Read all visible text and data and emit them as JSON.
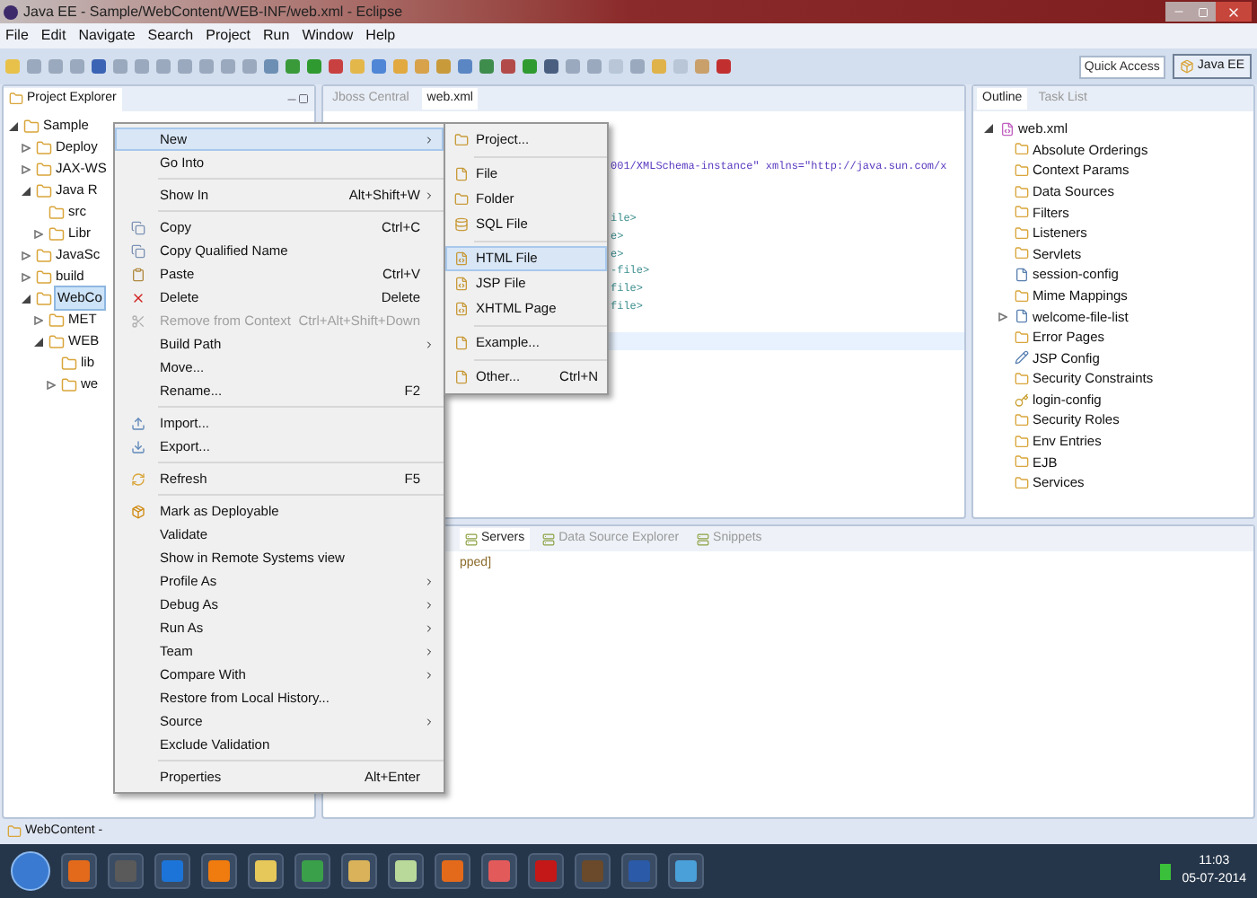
{
  "window": {
    "title": "Java EE - Sample/WebContent/WEB-INF/web.xml - Eclipse"
  },
  "menu_bar": [
    "File",
    "Edit",
    "Navigate",
    "Search",
    "Project",
    "Run",
    "Window",
    "Help"
  ],
  "quick_access": {
    "placeholder": "Quick Access"
  },
  "perspective": {
    "label": "Java EE",
    "selected": true
  },
  "project_explorer": {
    "tab": "Project Explorer",
    "tree": [
      {
        "label": "Sample",
        "expanded": true,
        "selected": false,
        "children": [
          {
            "label": "Deploy",
            "expanded": false,
            "selected": false
          },
          {
            "label": "JAX-WS",
            "expanded": false,
            "selected": false
          },
          {
            "label": "Java R",
            "expanded": true,
            "selected": false,
            "children": [
              {
                "label": "src",
                "selected": false
              },
              {
                "label": "Libr",
                "expanded": false,
                "selected": false
              }
            ]
          },
          {
            "label": "JavaSc",
            "expanded": false,
            "selected": false
          },
          {
            "label": "build",
            "expanded": false,
            "selected": false
          },
          {
            "label": "WebCo",
            "expanded": true,
            "selected": true,
            "children": [
              {
                "label": "MET",
                "expanded": false,
                "selected": false
              },
              {
                "label": "WEB",
                "expanded": true,
                "selected": false,
                "children": [
                  {
                    "label": "lib",
                    "selected": false
                  },
                  {
                    "label": "we",
                    "expanded": false,
                    "selected": false
                  }
                ]
              }
            ]
          }
        ]
      }
    ]
  },
  "editor": {
    "tabs": [
      {
        "label": "Jboss Central",
        "selected": false
      },
      {
        "label": "web.xml",
        "selected": true
      }
    ],
    "lines": [
      {
        "kind": "attribute",
        "text": "001/XMLSchema-instance\" xmlns=\"http://java.sun.com/x"
      },
      {
        "kind": "blank"
      },
      {
        "kind": "blank"
      },
      {
        "kind": "tag",
        "text": "ile>"
      },
      {
        "kind": "tag",
        "text": "e>"
      },
      {
        "kind": "tag",
        "text": "e>"
      },
      {
        "kind": "tag",
        "text": "-file>"
      },
      {
        "kind": "tag",
        "text": "file>"
      },
      {
        "kind": "tag",
        "text": "file>"
      },
      {
        "kind": "blank"
      },
      {
        "kind": "blank",
        "current": true
      }
    ]
  },
  "outline": {
    "tabs": [
      {
        "label": "Outline",
        "selected": true
      },
      {
        "label": "Task List",
        "selected": false
      }
    ],
    "root": {
      "label": "web.xml",
      "expanded": true
    },
    "items": [
      {
        "label": "Absolute Orderings",
        "kind": "folder"
      },
      {
        "label": "Context Params",
        "kind": "folder"
      },
      {
        "label": "Data Sources",
        "kind": "folder"
      },
      {
        "label": "Filters",
        "kind": "folder"
      },
      {
        "label": "Listeners",
        "kind": "folder"
      },
      {
        "label": "Servlets",
        "kind": "folder"
      },
      {
        "label": "session-config",
        "kind": "config"
      },
      {
        "label": "Mime Mappings",
        "kind": "folder"
      },
      {
        "label": "welcome-file-list",
        "kind": "list",
        "expanded": false
      },
      {
        "label": "Error Pages",
        "kind": "folder"
      },
      {
        "label": "JSP Config",
        "kind": "pen"
      },
      {
        "label": "Security Constraints",
        "kind": "folder"
      },
      {
        "label": "login-config",
        "kind": "key"
      },
      {
        "label": "Security Roles",
        "kind": "folder"
      },
      {
        "label": "Env Entries",
        "kind": "folder"
      },
      {
        "label": "EJB",
        "kind": "folder"
      },
      {
        "label": "Services",
        "kind": "folder"
      }
    ]
  },
  "bottom_panel": {
    "tabs": [
      {
        "label": "Servers",
        "selected": true
      },
      {
        "label": "Data Source Explorer",
        "selected": false
      },
      {
        "label": "Snippets",
        "selected": false
      }
    ],
    "content": "pped]"
  },
  "status_bar": "WebContent -",
  "context_menu": {
    "items": [
      {
        "kind": "item",
        "label": "New",
        "submenu": true,
        "selected": true,
        "disabled": false
      },
      {
        "kind": "item",
        "label": "Go Into",
        "submenu": false,
        "selected": false,
        "disabled": false
      },
      {
        "kind": "separator"
      },
      {
        "kind": "item",
        "label": "Show In",
        "shortcut": "Alt+Shift+W",
        "submenu": true,
        "selected": false,
        "disabled": false
      },
      {
        "kind": "separator"
      },
      {
        "kind": "item",
        "label": "Copy",
        "shortcut": "Ctrl+C",
        "submenu": false,
        "selected": false,
        "disabled": false
      },
      {
        "kind": "item",
        "label": "Copy Qualified Name",
        "submenu": false,
        "selected": false,
        "disabled": false
      },
      {
        "kind": "item",
        "label": "Paste",
        "shortcut": "Ctrl+V",
        "submenu": false,
        "selected": false,
        "disabled": false
      },
      {
        "kind": "item",
        "label": "Delete",
        "shortcut": "Delete",
        "submenu": false,
        "selected": false,
        "disabled": false
      },
      {
        "kind": "item",
        "label": "Remove from Context",
        "shortcut": "Ctrl+Alt+Shift+Down",
        "submenu": false,
        "selected": false,
        "disabled": true
      },
      {
        "kind": "item",
        "label": "Build Path",
        "submenu": true,
        "selected": false,
        "disabled": false
      },
      {
        "kind": "item",
        "label": "Move...",
        "submenu": false,
        "selected": false,
        "disabled": false
      },
      {
        "kind": "item",
        "label": "Rename...",
        "shortcut": "F2",
        "submenu": false,
        "selected": false,
        "disabled": false
      },
      {
        "kind": "separator"
      },
      {
        "kind": "item",
        "label": "Import...",
        "submenu": false,
        "selected": false,
        "disabled": false
      },
      {
        "kind": "item",
        "label": "Export...",
        "submenu": false,
        "selected": false,
        "disabled": false
      },
      {
        "kind": "separator"
      },
      {
        "kind": "item",
        "label": "Refresh",
        "shortcut": "F5",
        "submenu": false,
        "selected": false,
        "disabled": false
      },
      {
        "kind": "separator"
      },
      {
        "kind": "item",
        "label": "Mark as Deployable",
        "submenu": false,
        "selected": false,
        "disabled": false
      },
      {
        "kind": "item",
        "label": "Validate",
        "submenu": false,
        "selected": false,
        "disabled": false
      },
      {
        "kind": "item",
        "label": "Show in Remote Systems view",
        "submenu": false,
        "selected": false,
        "disabled": false
      },
      {
        "kind": "item",
        "label": "Profile As",
        "submenu": true,
        "selected": false,
        "disabled": false
      },
      {
        "kind": "item",
        "label": "Debug As",
        "submenu": true,
        "selected": false,
        "disabled": false
      },
      {
        "kind": "item",
        "label": "Run As",
        "submenu": true,
        "selected": false,
        "disabled": false
      },
      {
        "kind": "item",
        "label": "Team",
        "submenu": true,
        "selected": false,
        "disabled": false
      },
      {
        "kind": "item",
        "label": "Compare With",
        "submenu": true,
        "selected": false,
        "disabled": false
      },
      {
        "kind": "item",
        "label": "Restore from Local History...",
        "submenu": false,
        "selected": false,
        "disabled": false
      },
      {
        "kind": "item",
        "label": "Source",
        "submenu": true,
        "selected": false,
        "disabled": false
      },
      {
        "kind": "item",
        "label": "Exclude Validation",
        "submenu": false,
        "selected": false,
        "disabled": false
      },
      {
        "kind": "separator"
      },
      {
        "kind": "item",
        "label": "Properties",
        "shortcut": "Alt+Enter",
        "submenu": false,
        "selected": false,
        "disabled": false
      }
    ]
  },
  "new_submenu": {
    "items": [
      {
        "kind": "item",
        "label": "Project...",
        "selected": false
      },
      {
        "kind": "separator"
      },
      {
        "kind": "item",
        "label": "File",
        "selected": false
      },
      {
        "kind": "item",
        "label": "Folder",
        "selected": false
      },
      {
        "kind": "item",
        "label": "SQL File",
        "selected": false
      },
      {
        "kind": "separator"
      },
      {
        "kind": "item",
        "label": "HTML File",
        "selected": true
      },
      {
        "kind": "item",
        "label": "JSP File",
        "selected": false
      },
      {
        "kind": "item",
        "label": "XHTML Page",
        "selected": false
      },
      {
        "kind": "separator"
      },
      {
        "kind": "item",
        "label": "Example...",
        "selected": false
      },
      {
        "kind": "separator"
      },
      {
        "kind": "item",
        "label": "Other...",
        "shortcut": "Ctrl+N",
        "selected": false
      }
    ]
  },
  "taskbar": {
    "time": "11:03",
    "date": "05-07-2014"
  }
}
